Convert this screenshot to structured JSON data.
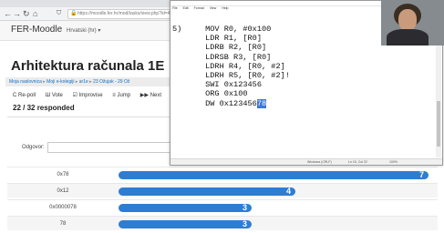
{
  "browser": {
    "url": "https://moodle.fer.hr/mod/tasks/view.php?id=4"
  },
  "moodle": {
    "site_name": "FER-Moodle",
    "language": "Hrvatski (hr) ▾",
    "course_title": "Arhitektura računala 1E",
    "breadcrumb": [
      "Moja naslovnica",
      "Moji e-kolegiji",
      "ar1e",
      "23 Ožujak - 29 Ož"
    ],
    "toolbar": [
      "C Re-poll",
      "Ш Vote",
      "☑ Improvise",
      "≡ Jump",
      "▶▶ Next"
    ],
    "responded": "22 / 32 responded",
    "answer_label": "Odgovor:"
  },
  "results": [
    {
      "label": "0x78",
      "count": "7",
      "fraction": 1.0
    },
    {
      "label": "0x12",
      "count": "4",
      "fraction": 0.571
    },
    {
      "label": "0x0000078",
      "count": "3",
      "fraction": 0.429
    },
    {
      "label": "78",
      "count": "3",
      "fraction": 0.429
    }
  ],
  "editor": {
    "menu": [
      "File",
      "Edit",
      "Format",
      "View",
      "Help"
    ],
    "code_lines": [
      "5)     MOV R0, #0x100",
      "",
      "       LDR R1, [R0]",
      "       LDRB R2, [R0]",
      "       LDRSB R3, [R0]",
      "",
      "       LDRH R4, [R0, #2]",
      "       LDRH R5, [R0, #2]!",
      "",
      "       SWI 0x123456",
      "",
      "       ORG 0x100"
    ],
    "last_line_prefix": "       DW 0x123456",
    "last_line_selected": "78",
    "status": {
      "encoding": "Windows (CRLF)",
      "position": "Ln 15, Col 22",
      "zoom": "100%"
    }
  },
  "colors": {
    "bar": "#2f7dd3",
    "selection": "#3a78d8",
    "link": "#0f6fc5"
  }
}
